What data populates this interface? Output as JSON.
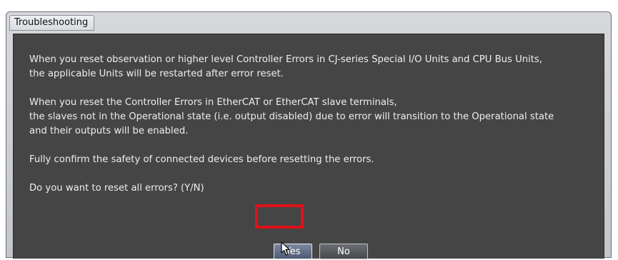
{
  "window": {
    "title": "Troubleshooting"
  },
  "message": {
    "para1_line1": "When you reset observation or higher level Controller Errors in CJ-series Special I/O Units and CPU Bus Units,",
    "para1_line2": "the applicable Units will be restarted after error reset.",
    "para2_line1": "When you reset the Controller Errors in EtherCAT or EtherCAT slave terminals,",
    "para2_line2": "the slaves not in the Operational state (i.e. output disabled) due to error will transition to the Operational state",
    "para2_line3": "and their outputs will be enabled.",
    "para3": "Fully confirm the safety of connected devices before resetting the errors.",
    "question": "Do you want to reset all errors? (Y/N)"
  },
  "buttons": {
    "yes_label": "Yes",
    "no_label": "No"
  },
  "colors": {
    "content_background": "#454545",
    "highlight": "#e1101a",
    "text": "#eeeeee"
  },
  "icons": {
    "cursor": "mouse-pointer-icon"
  }
}
